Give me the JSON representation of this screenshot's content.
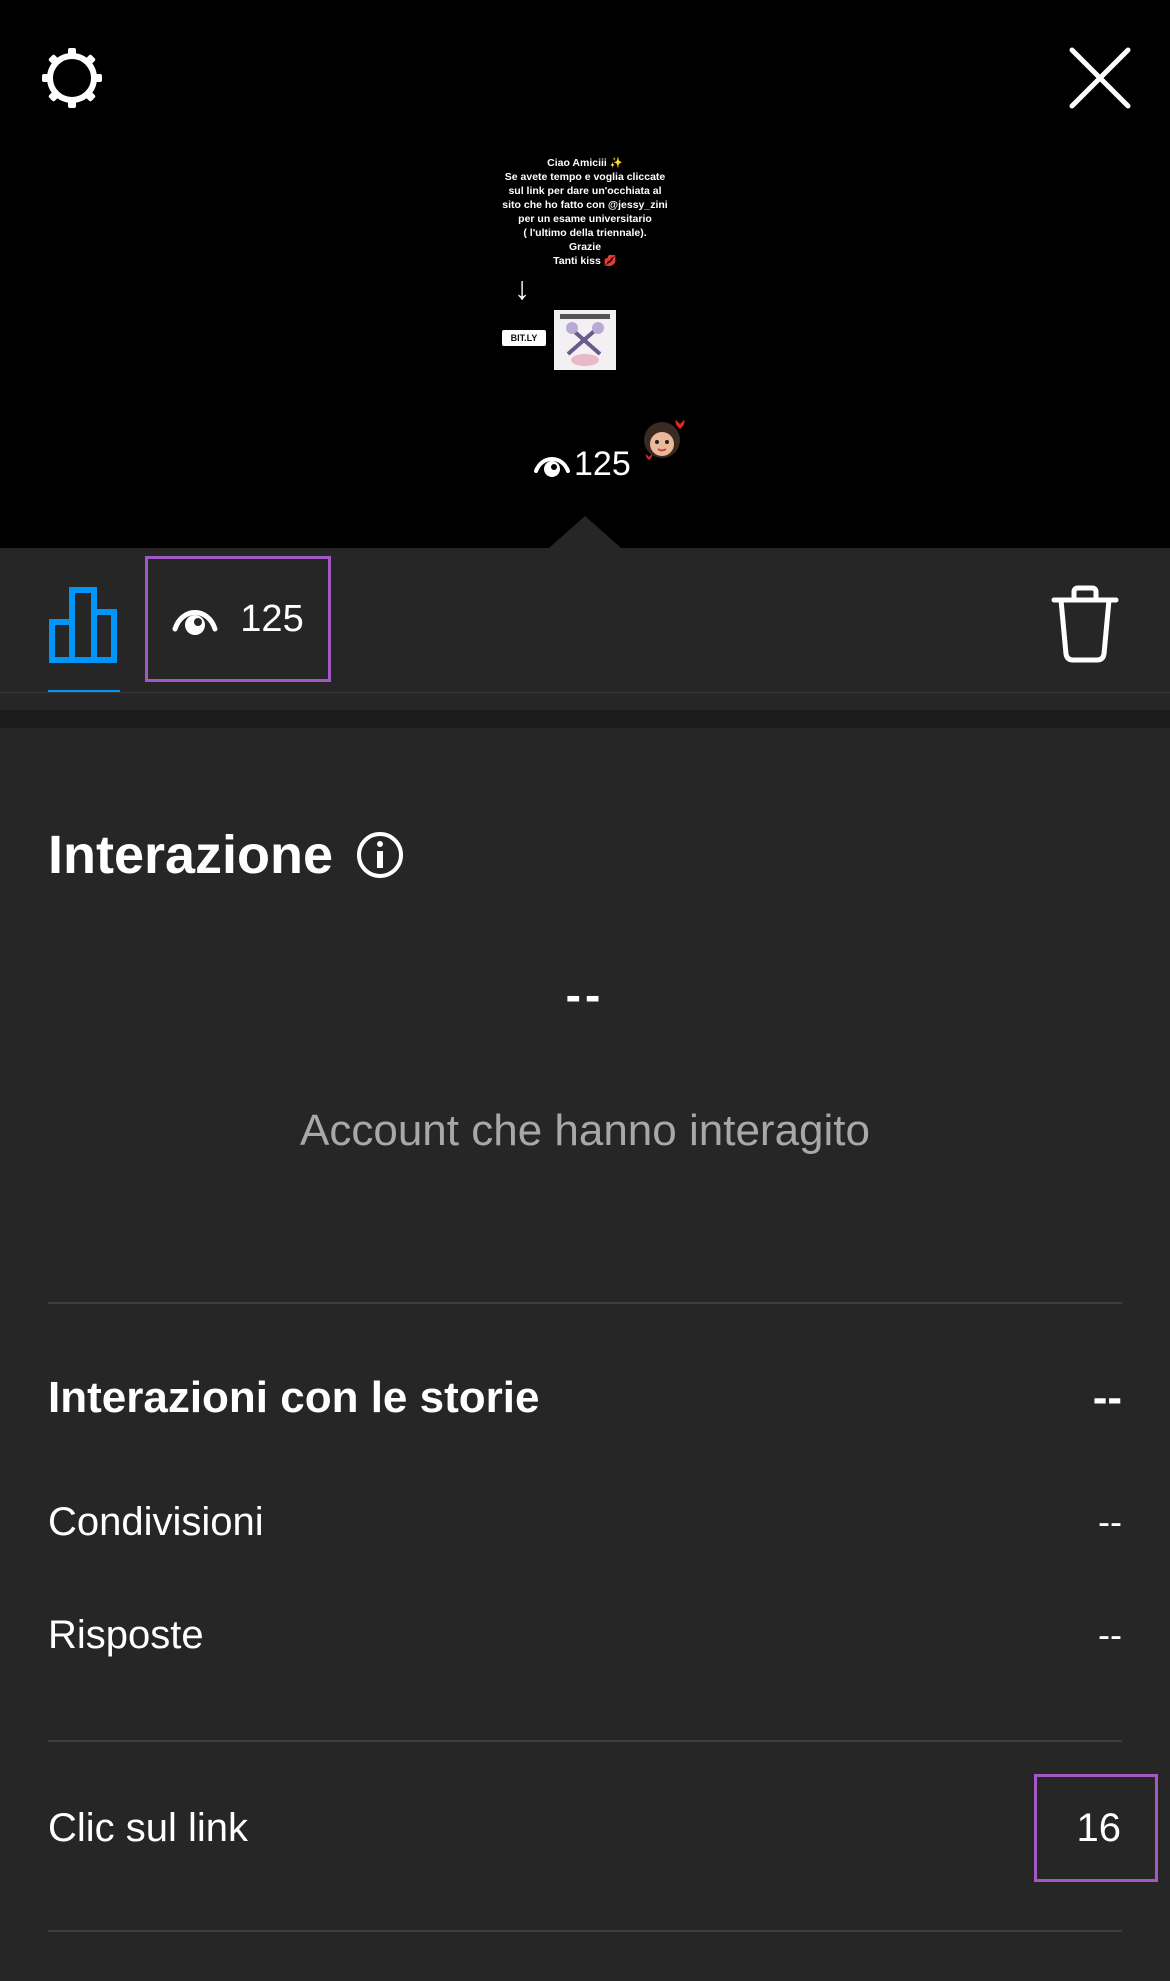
{
  "story": {
    "text_lines": "Ciao Amiciii ✨\nSe avete tempo e voglia cliccate\nsul link per dare un'occhiata al\nsito che ho fatto con @jessy_zini\nper un esame universitario\n( l'ultimo della triennale).\nGrazie\nTanti kiss 💋",
    "link_sticker": "BIT.LY",
    "views": "125"
  },
  "tabs": {
    "viewers_count": "125"
  },
  "section": {
    "title": "Interazione",
    "accounts_value": "--",
    "accounts_caption": "Account che hanno interagito"
  },
  "rows": {
    "story_interactions_label": "Interazioni con le storie",
    "story_interactions_value": "--",
    "shares_label": "Condivisioni",
    "shares_value": "--",
    "replies_label": "Risposte",
    "replies_value": "--",
    "link_clicks_label": "Clic sul link",
    "link_clicks_value": "16"
  },
  "colors": {
    "accent": "#0095f6",
    "highlight_box": "#a259c6",
    "panel_bg": "#262626",
    "muted_text": "#a8a8a8"
  }
}
